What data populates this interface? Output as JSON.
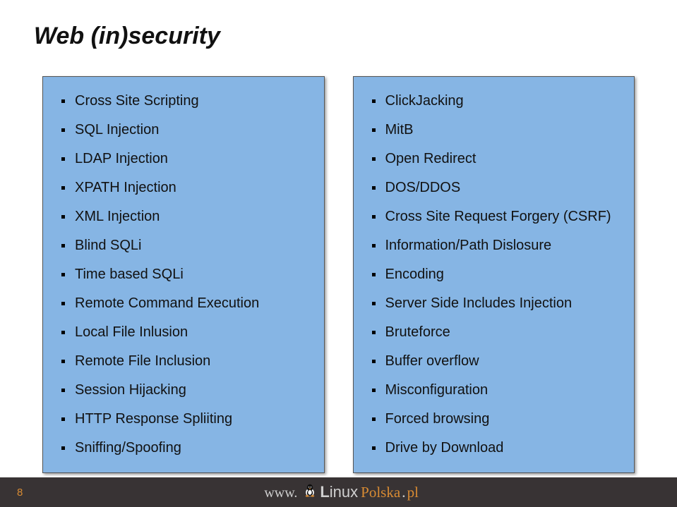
{
  "title": "Web (in)security",
  "watermark_top": "",
  "watermark_bottom": "",
  "left_column": [
    "Cross Site Scripting",
    "SQL Injection",
    "LDAP Injection",
    "XPATH Injection",
    "XML Injection",
    "Blind SQLi",
    "Time based SQLi",
    "Remote Command Execution",
    "Local File Inlusion",
    "Remote File Inclusion",
    "Session Hijacking",
    "HTTP Response Spliiting",
    "Sniffing/Spoofing"
  ],
  "right_column": [
    "ClickJacking",
    "MitB",
    "Open Redirect",
    "DOS/DDOS",
    "Cross Site Request Forgery (CSRF)",
    "Information/Path Dislosure",
    "Encoding",
    "Server Side Includes Injection",
    "Bruteforce",
    "Buffer overflow",
    "Misconfiguration",
    "Forced browsing",
    "Drive by Download"
  ],
  "page_number": "8",
  "brand": {
    "www": "www.",
    "linux_l": "L",
    "linux_rest": "inux",
    "polska": "Polska",
    "pl": "pl"
  }
}
